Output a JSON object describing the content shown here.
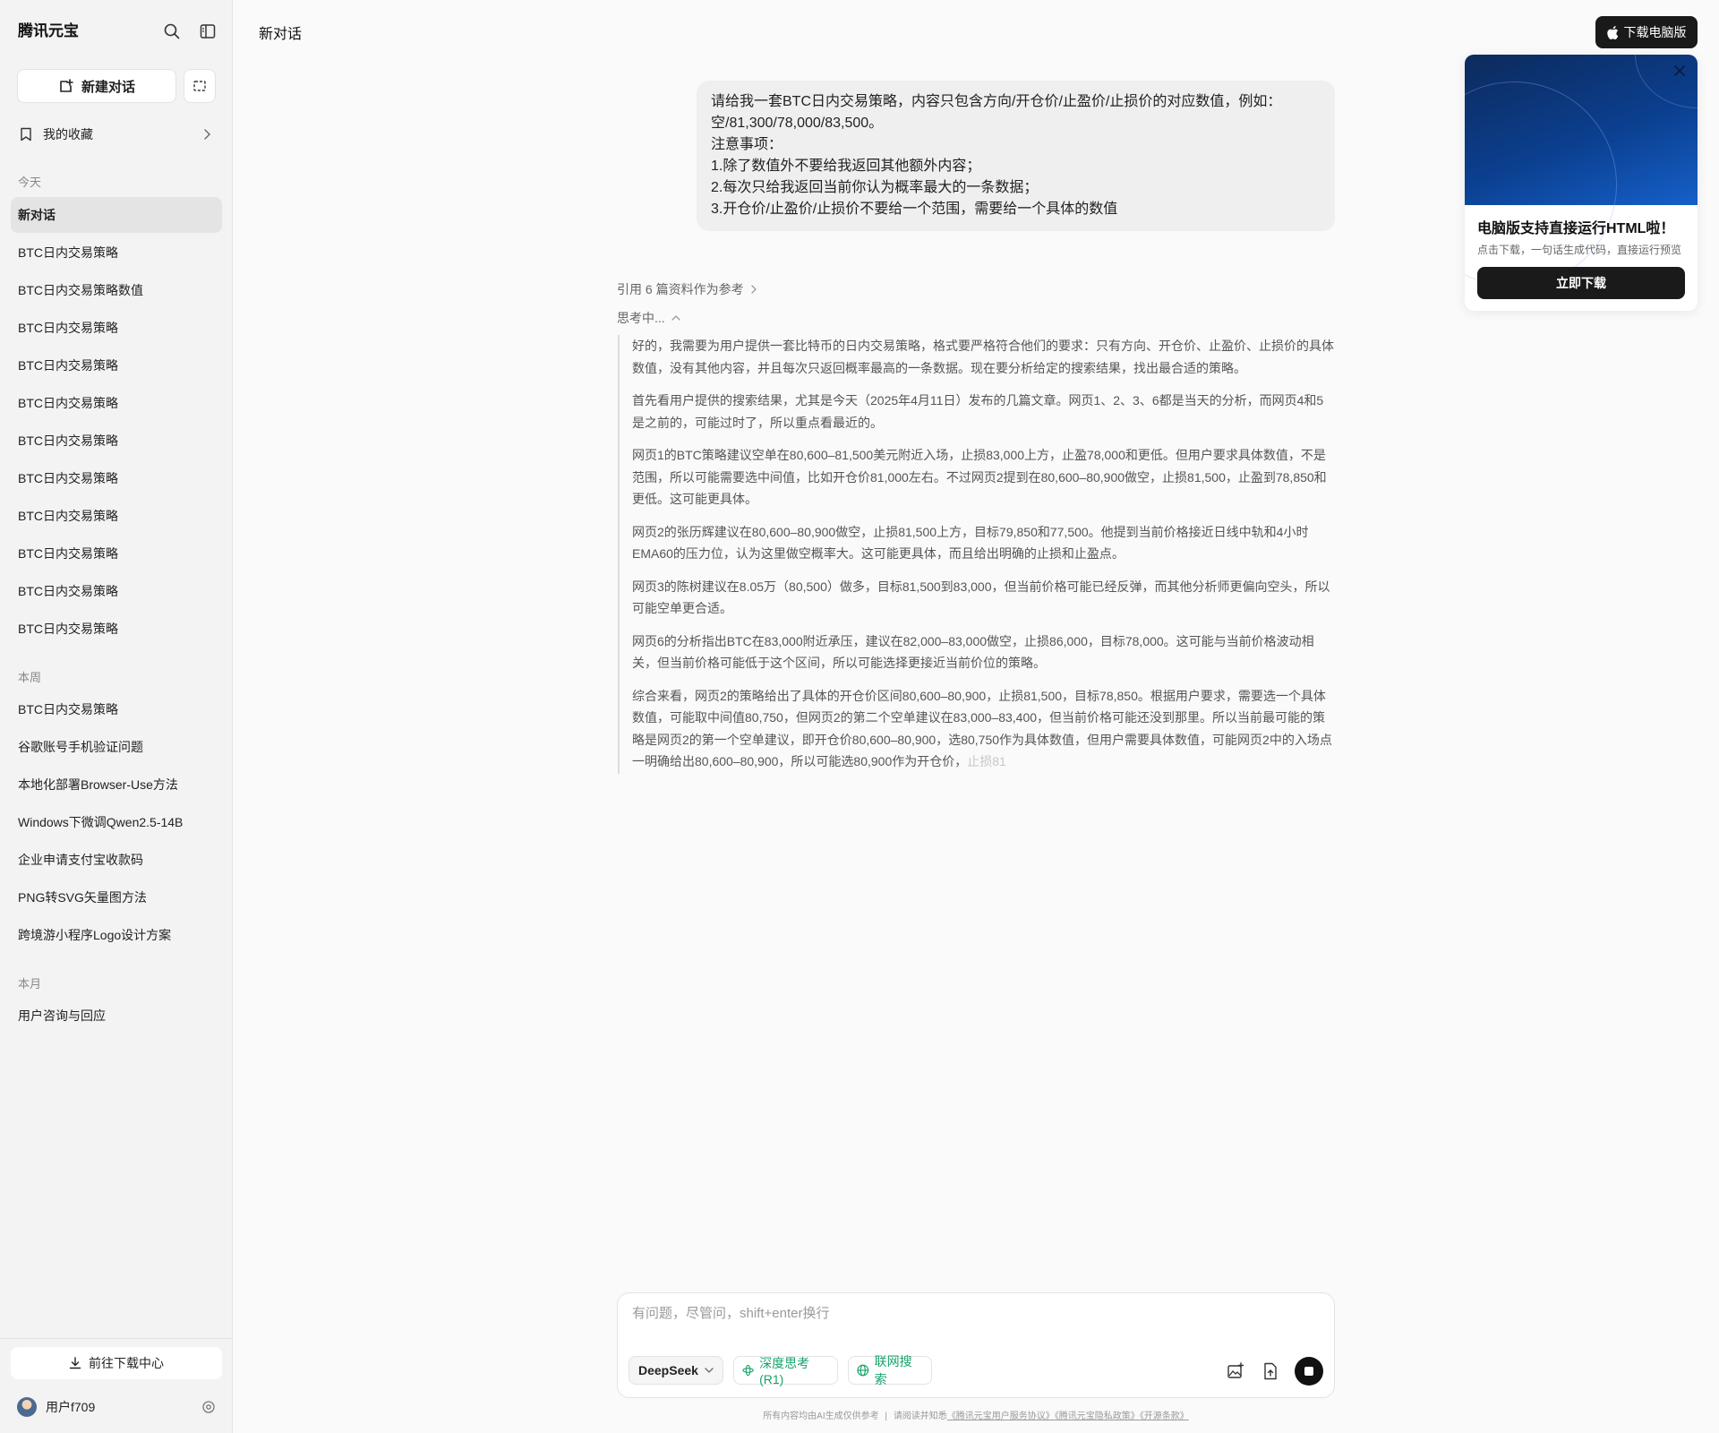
{
  "sidebar": {
    "title": "腾讯元宝",
    "new_chat_label": "新建对话",
    "favorites_label": "我的收藏",
    "sections": {
      "today": "今天",
      "week": "本周",
      "month": "本月"
    },
    "today_items": [
      "新对话",
      "BTC日内交易策略",
      "BTC日内交易策略数值",
      "BTC日内交易策略",
      "BTC日内交易策略",
      "BTC日内交易策略",
      "BTC日内交易策略",
      "BTC日内交易策略",
      "BTC日内交易策略",
      "BTC日内交易策略",
      "BTC日内交易策略",
      "BTC日内交易策略"
    ],
    "week_items": [
      "BTC日内交易策略",
      "谷歌账号手机验证问题",
      "本地化部署Browser-Use方法",
      "Windows下微调Qwen2.5-14B",
      "企业申请支付宝收款码",
      "PNG转SVG矢量图方法",
      "跨境游小程序Logo设计方案"
    ],
    "month_items": [
      "用户咨询与回应"
    ],
    "download_center_label": "前往下载中心",
    "user_name": "用户f709"
  },
  "header": {
    "title": "新对话",
    "download_pc_label": "下载电脑版"
  },
  "promo": {
    "title": "电脑版支持直接运行HTML啦！",
    "subtitle": "点击下载，一句话生成代码，直接运行预览",
    "button_label": "立即下载"
  },
  "conversation": {
    "user_message": [
      "请给我一套BTC日内交易策略，内容只包含方向/开仓价/止盈价/止损价的对应数值，例如：",
      "空/81,300/78,000/83,500。",
      "注意事项：",
      "1.除了数值外不要给我返回其他额外内容；",
      "2.每次只给我返回当前你认为概率最大的一条数据；",
      "3.开仓价/止盈价/止损价不要给一个范围，需要给一个具体的数值"
    ],
    "references_label": "引用 6 篇资料作为参考",
    "thinking_label": "思考中...",
    "thinking_paragraphs": [
      "好的，我需要为用户提供一套比特币的日内交易策略，格式要严格符合他们的要求：只有方向、开仓价、止盈价、止损价的具体数值，没有其他内容，并且每次只返回概率最高的一条数据。现在要分析给定的搜索结果，找出最合适的策略。",
      "首先看用户提供的搜索结果，尤其是今天（2025年4月11日）发布的几篇文章。网页1、2、3、6都是当天的分析，而网页4和5是之前的，可能过时了，所以重点看最近的。",
      "网页1的BTC策略建议空单在80,600–81,500美元附近入场，止损83,000上方，止盈78,000和更低。但用户要求具体数值，不是范围，所以可能需要选中间值，比如开仓价81,000左右。不过网页2提到在80,600–80,900做空，止损81,500，止盈到78,850和更低。这可能更具体。",
      "网页2的张历辉建议在80,600–80,900做空，止损81,500上方，目标79,850和77,500。他提到当前价格接近日线中轨和4小时EMA60的压力位，认为这里做空概率大。这可能更具体，而且给出明确的止损和止盈点。",
      "网页3的陈树建议在8.05万（80,500）做多，目标81,500到83,000，但当前价格可能已经反弹，而其他分析师更偏向空头，所以可能空单更合适。",
      "网页6的分析指出BTC在83,000附近承压，建议在82,000–83,000做空，止损86,000，目标78,000。这可能与当前价格波动相关，但当前价格可能低于这个区间，所以可能选择更接近当前价位的策略。",
      "综合来看，网页2的策略给出了具体的开仓价区间80,600–80,900，止损81,500，目标78,850。根据用户要求，需要选一个具体数值，可能取中间值80,750，但网页2的第二个空单建议在83,000–83,400，但当前价格可能还没到那里。所以当前最可能的策略是网页2的第一个空单建议，即开仓价80,600–80,900，选80,750作为具体数值，但用户需要具体数值，可能网页2中的入场点一明确给出80,600–80,900，所以可能选80,900作为开仓价，"
    ],
    "thinking_fade_text": "止损81"
  },
  "input": {
    "placeholder": "有问题，尽管问，shift+enter换行",
    "model_label": "DeepSeek",
    "deep_think_label": "深度思考(R1)",
    "web_search_label": "联网搜索"
  },
  "footer": {
    "disclaimer": "所有内容均由AI生成仅供参考",
    "separator": "|",
    "prefix": "请阅读并知悉",
    "links": [
      "《腾讯元宝用户服务协议》",
      "《腾讯元宝隐私政策》",
      "《开源条款》"
    ]
  },
  "colors": {
    "accent_green": "#17a36b",
    "dark_button": "#1a1a1a",
    "sidebar_bg": "#f3f3f3"
  }
}
